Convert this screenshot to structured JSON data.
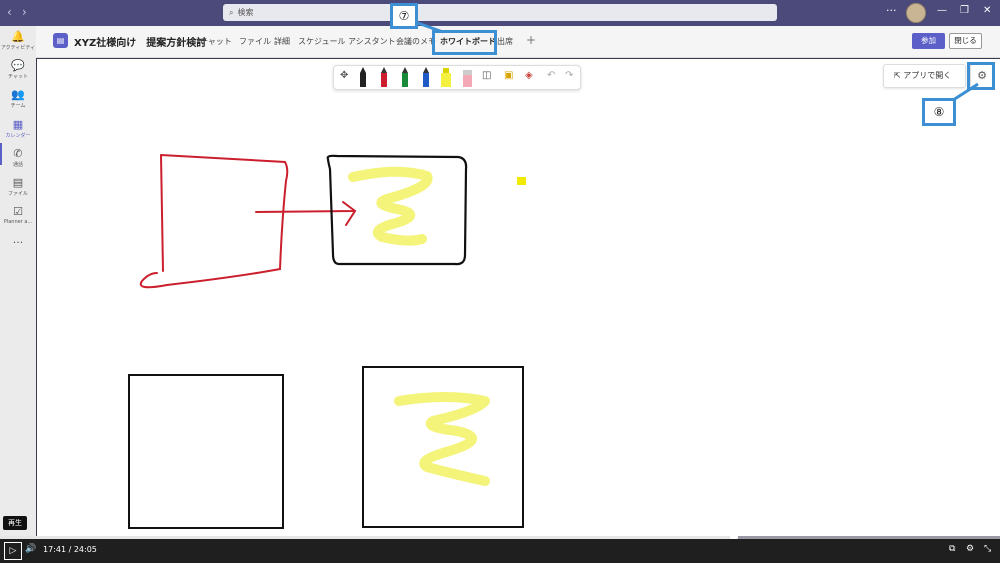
{
  "titlebar": {
    "back_icon": "‹",
    "forward_icon": "›",
    "search_placeholder": "検索",
    "more_icon": "···",
    "minimize_icon": "—",
    "maximize_icon": "❐",
    "close_icon": "✕"
  },
  "rail": {
    "items": [
      {
        "icon": "🔔",
        "label": "アクティビティ"
      },
      {
        "icon": "💬",
        "label": "チャット"
      },
      {
        "icon": "👥",
        "label": "チーム"
      },
      {
        "icon": "▦",
        "label": "カレンダー"
      },
      {
        "icon": "✆",
        "label": "通話"
      },
      {
        "icon": "▤",
        "label": "ファイル"
      },
      {
        "icon": "☑",
        "label": "Planner a..."
      },
      {
        "icon": "···",
        "label": ""
      }
    ]
  },
  "header": {
    "team_title": "XYZ社様向け　提案方針検討",
    "tabs": [
      "チャット",
      "ファイル",
      "詳細",
      "スケジュール アシスタント",
      "会議のメモ",
      "ホワイトボード",
      "出席"
    ],
    "add_tab": "+",
    "join_label": "参加",
    "close_label": "閉じる"
  },
  "callouts": {
    "seven": "⑦",
    "eight": "⑧"
  },
  "board": {
    "open_app_label": "アプリで開く",
    "settings_icon": "⚙",
    "toolbar": [
      "✥",
      "",
      "",
      "",
      "",
      "",
      "",
      "◫",
      "▣",
      "◈",
      "↶",
      "↷"
    ]
  },
  "player": {
    "tooltip": "再生",
    "play_icon": "▷",
    "volume_icon": "🔊",
    "time": "17:41 / 24:05",
    "captions_icon": "⧉",
    "settings_icon": "⚙",
    "fullscreen_icon": "⤡",
    "progress": 0.734
  },
  "colors": {
    "accent": "#5b5fc7",
    "annotation": "#3c8fd3",
    "red_ink": "#cc1f2e",
    "highlighter": "#f4f47a",
    "yellow_note": "#f2ea00"
  }
}
